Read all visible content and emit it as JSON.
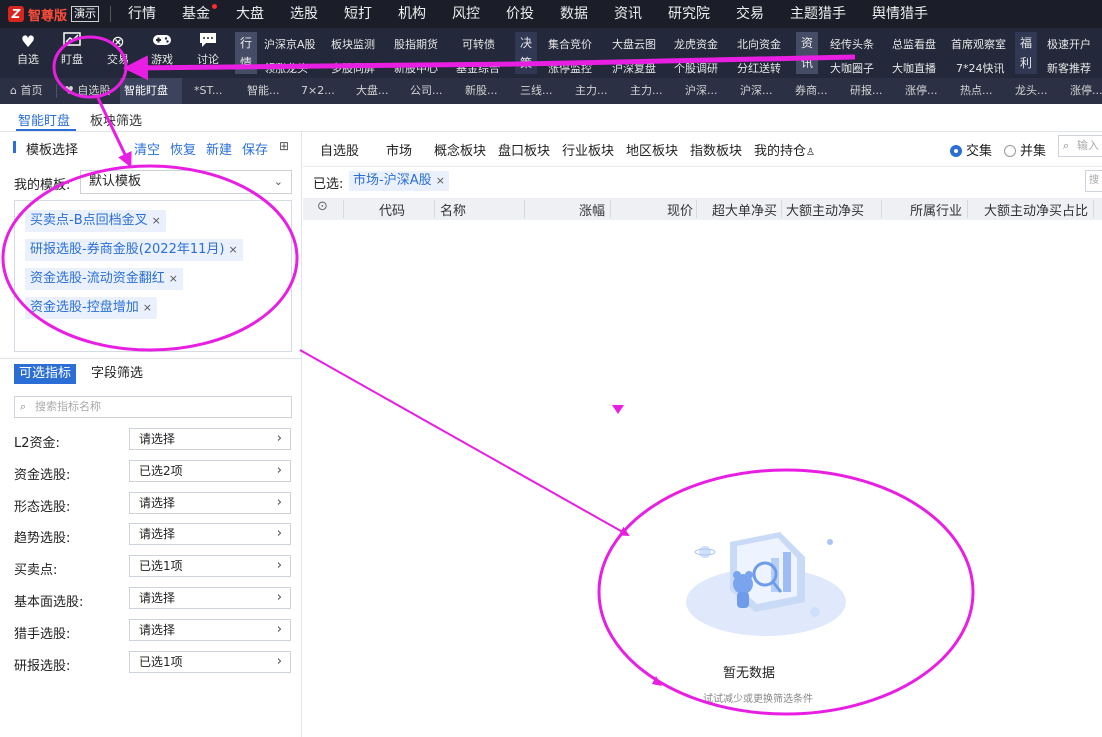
{
  "topbar": {
    "brand": "智尊版",
    "demo": "演示",
    "menu": [
      "行情",
      "基金",
      "大盘",
      "选股",
      "短打",
      "机构",
      "风控",
      "价投",
      "数据",
      "资讯",
      "研究院",
      "交易",
      "主题猎手",
      "舆情猎手"
    ]
  },
  "toolbar": {
    "icons": [
      {
        "label": "自选",
        "icon": "heart-icon"
      },
      {
        "label": "盯盘",
        "icon": "chart-icon"
      },
      {
        "label": "交易",
        "icon": "trade-icon"
      },
      {
        "label": "游戏",
        "icon": "gamepad-icon"
      },
      {
        "label": "讨论",
        "icon": "chat-icon"
      }
    ],
    "group1": {
      "tag": "行情",
      "row1": [
        "沪深京A股",
        "板块监测",
        "股指期货",
        "可转债"
      ],
      "row2": [
        "领涨龙头",
        "多股同屏",
        "新股中心",
        "基金综合"
      ]
    },
    "group2": {
      "tag": "决策",
      "row1": [
        "集合竞价",
        "大盘云图",
        "龙虎资金",
        "北向资金"
      ],
      "row2": [
        "涨停监控",
        "沪深复盘",
        "个股调研",
        "分红送转"
      ]
    },
    "group3": {
      "tag": "资讯",
      "row1": [
        "经传头条",
        "总监看盘",
        "首席观察室"
      ],
      "row2": [
        "大咖圈子",
        "大咖直播",
        "7*24快讯"
      ]
    },
    "group4": {
      "tag": "福利",
      "row1": [
        "极速开户"
      ],
      "row2": [
        "新客推荐"
      ]
    }
  },
  "tabs": [
    "首页",
    "自选股",
    "智能盯盘",
    "*ST...",
    "智能...",
    "7×2...",
    "大盘...",
    "公司...",
    "新股...",
    "三线...",
    "主力...",
    "主力...",
    "沪深...",
    "沪深...",
    "券商...",
    "研报...",
    "涨停...",
    "热点...",
    "龙头...",
    "涨停..."
  ],
  "subtabs": {
    "smart": "智能盯盘",
    "sector": "板块筛选"
  },
  "template": {
    "title": "模板选择",
    "actions": {
      "clear": "清空",
      "restore": "恢复",
      "new": "新建",
      "save": "保存"
    },
    "my_label": "我的模板:",
    "my_value": "默认模板",
    "chips": [
      "买卖点-B点回档金叉",
      "研报选股-券商金股(2022年11月)",
      "资金选股-流动资金翻红",
      "资金选股-控盘增加"
    ]
  },
  "indicators": {
    "tab_optional": "可选指标",
    "tab_field": "字段筛选",
    "search_placeholder": "搜索指标名称",
    "filters": [
      {
        "label": "L2资金:",
        "value": "请选择"
      },
      {
        "label": "资金选股:",
        "value": "已选2项"
      },
      {
        "label": "形态选股:",
        "value": "请选择"
      },
      {
        "label": "趋势选股:",
        "value": "请选择"
      },
      {
        "label": "买卖点:",
        "value": "已选1项"
      },
      {
        "label": "基本面选股:",
        "value": "请选择"
      },
      {
        "label": "猎手选股:",
        "value": "请选择"
      },
      {
        "label": "研报选股:",
        "value": "已选1项"
      }
    ]
  },
  "market_tabs": [
    "自选股",
    "市场",
    "概念板块",
    "盘口板块",
    "行业板块",
    "地区板块",
    "指数板块",
    "我的持仓"
  ],
  "radios": {
    "intersect": "交集",
    "union": "并集"
  },
  "right_search_placeholder": "输入",
  "selected": {
    "label": "已选:",
    "chip": "市场-沪深A股"
  },
  "table_headers": [
    "代码",
    "名称",
    "涨幅",
    "现价",
    "超大单净买",
    "大额主动净买",
    "所属行业",
    "大额主动净买占比"
  ],
  "empty": {
    "title": "暂无数据",
    "subtitle": "试试减少或更换筛选条件"
  }
}
